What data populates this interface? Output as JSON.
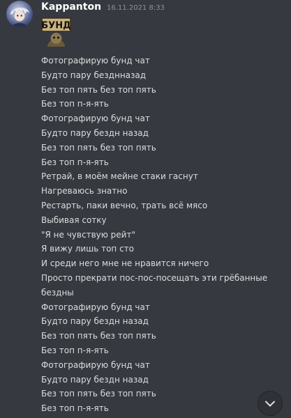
{
  "message": {
    "author": "Kappanton",
    "timestamp": "16.11.2021 8:33",
    "emoji_text": "БУНД",
    "avatar_icon": "anime-character-avatar",
    "lines": [
      "Фотографирую бунд чат",
      "Будто пару безднназад",
      "Без топ пять без топ пять",
      "Без топ п-я-ять",
      "Фотографирую бунд чат",
      "Будто пару бездн назад",
      "Без топ пять без топ пять",
      "Без топ п-я-ять",
      "Ретрай, в моём мейне стаки гаснут",
      "Нагреваюсь знатно",
      "Рестарть, паки вечно, трать всё мясо",
      "Выбивая сотку",
      "\"Я не чувствую рейт\"",
      "Я вижу лишь топ сто",
      "И среди него мне не нравится ничего",
      "Просто прекрати пос-пос-посещать эти грёбанные",
      "бездны",
      "Фотографирую бунд чат",
      "Будто пару бездн назад",
      "Без топ пять без топ пять",
      "Без топ п-я-ять",
      "Фотографирую бунд чат",
      "Будто пару бездн назад",
      "Без топ пять без топ пять",
      "Без топ п-я-ять"
    ]
  },
  "jump_button": {
    "icon": "chevron-down-icon"
  },
  "colors": {
    "background": "#36393f",
    "username": "#ffffff",
    "timestamp": "#8e9297",
    "text": "#dcddde",
    "emoji_background": "#c8b484"
  }
}
